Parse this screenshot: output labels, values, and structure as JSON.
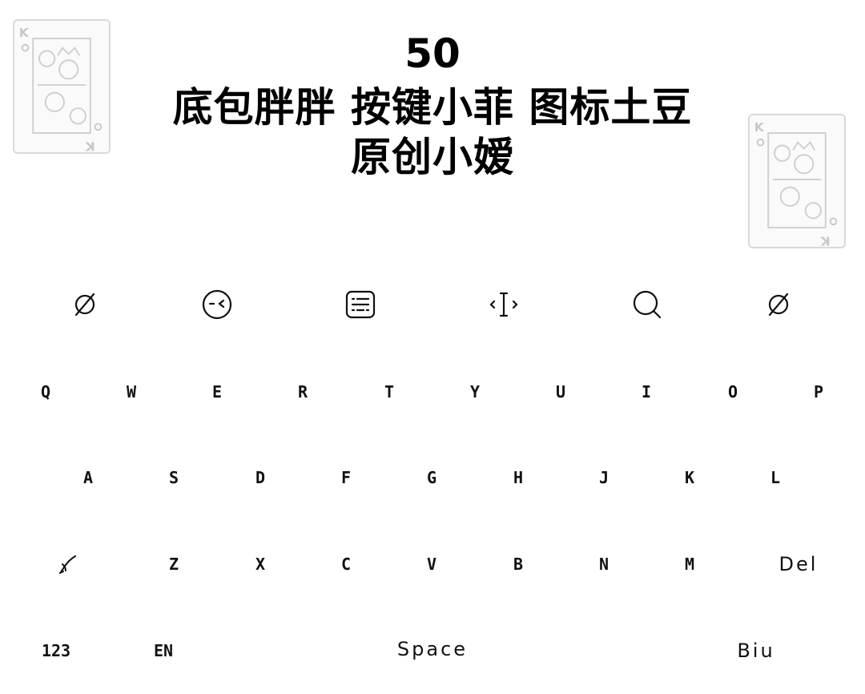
{
  "header": {
    "line1": "50",
    "line2": "底包胖胖 按键小菲 图标土豆",
    "line3": "原创小嫒"
  },
  "decor": {
    "card_rank": "K",
    "card_suit_icon": "club-icon"
  },
  "toolbar": {
    "icons": [
      "empty-set-icon",
      "wink-face-icon",
      "keyboard-icon",
      "text-cursor-icon",
      "search-icon",
      "empty-set-icon"
    ]
  },
  "keyboard": {
    "row1": [
      "Q",
      "W",
      "E",
      "R",
      "T",
      "Y",
      "U",
      "I",
      "O",
      "P"
    ],
    "row2": [
      "A",
      "S",
      "D",
      "F",
      "G",
      "H",
      "J",
      "K",
      "L"
    ],
    "row3": {
      "shift_icon": "pen-slash-icon",
      "keys": [
        "Z",
        "X",
        "C",
        "V",
        "B",
        "N",
        "M"
      ],
      "delete": "Del"
    },
    "row4": {
      "numbers": "123",
      "language": "EN",
      "space": "Space",
      "return": "Biu"
    }
  },
  "colors": {
    "background": "#ffffff",
    "text": "#111111",
    "decor": "#d9d9d9"
  }
}
